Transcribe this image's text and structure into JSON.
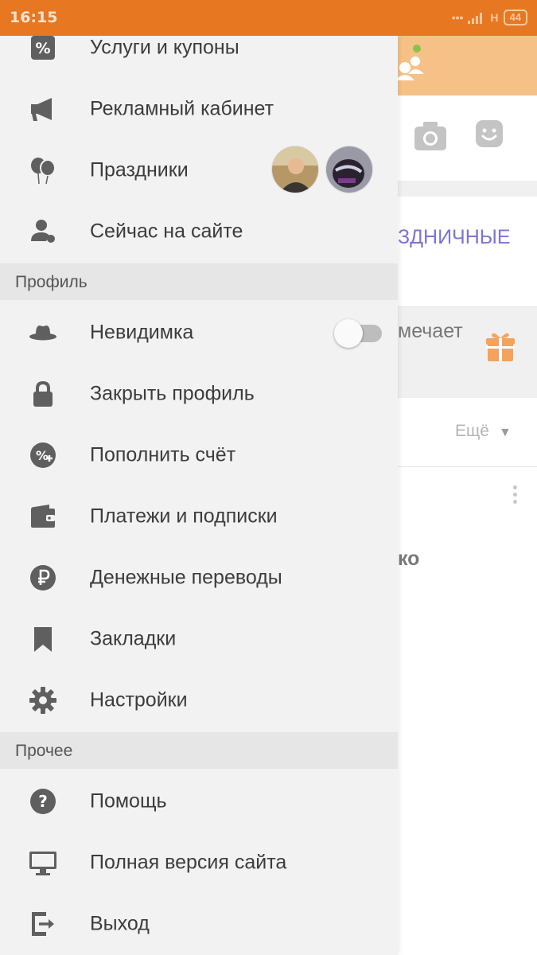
{
  "status_bar": {
    "time": "16:15",
    "network": "H",
    "battery": "44"
  },
  "background": {
    "promo_text": "ЗДНИЧНЫЕ",
    "notes_text": "мечает",
    "more_label": "Ещё",
    "more_arrow": "▼",
    "name_fragment": "ко"
  },
  "drawer": {
    "items_top": [
      {
        "icon": "percent-coupon-icon",
        "label": "Услуги и купоны"
      },
      {
        "icon": "megaphone-icon",
        "label": "Рекламный кабинет"
      },
      {
        "icon": "balloons-icon",
        "label": "Праздники"
      },
      {
        "icon": "person-online-icon",
        "label": "Сейчас на сайте"
      }
    ],
    "section_profile": "Профиль",
    "items_profile": [
      {
        "icon": "hat-icon",
        "label": "Невидимка"
      },
      {
        "icon": "lock-icon",
        "label": "Закрыть профиль"
      },
      {
        "icon": "coin-plus-icon",
        "label": "Пополнить счёт"
      },
      {
        "icon": "wallet-icon",
        "label": "Платежи и подписки"
      },
      {
        "icon": "ruble-icon",
        "label": "Денежные переводы"
      },
      {
        "icon": "bookmark-icon",
        "label": "Закладки"
      },
      {
        "icon": "gear-icon",
        "label": "Настройки"
      }
    ],
    "section_other": "Прочее",
    "items_other": [
      {
        "icon": "help-icon",
        "label": "Помощь"
      },
      {
        "icon": "monitor-icon",
        "label": "Полная версия сайта"
      },
      {
        "icon": "exit-icon",
        "label": "Выход"
      }
    ],
    "invisible_toggle_on": false
  },
  "colors": {
    "status_bar": "#e87722",
    "header": "#f6c187",
    "drawer_bg": "#f2f2f2",
    "section_bg": "#e6e6e6",
    "icon": "#5f5f5f",
    "promo": "#7b74d8",
    "gift": "#f5a35c"
  }
}
